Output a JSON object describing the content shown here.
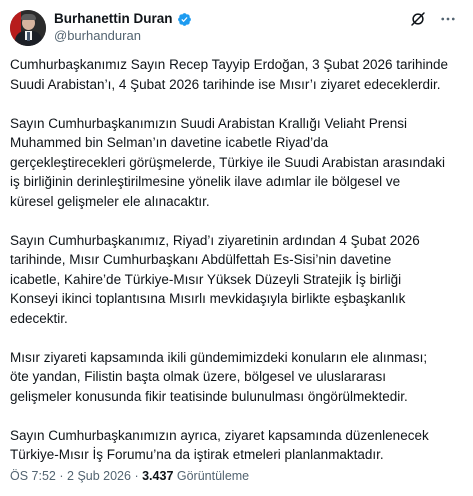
{
  "author": {
    "display_name": "Burhanettin Duran",
    "handle": "@burhanduran",
    "avatar_icon": "profile-photo",
    "verified_color": "#1d9bf0"
  },
  "actions": {
    "grok_icon": "grok-icon",
    "more_icon": "more-options-icon"
  },
  "tweet": {
    "paragraphs": [
      "Cumhurbaşkanımız Sayın Recep Tayyip Erdoğan, 3 Şubat 2026 tarihinde\nSuudi Arabistan’ı, 4 Şubat 2026 tarihinde ise Mısır’ı ziyaret edeceklerdir.",
      "Sayın Cumhurbaşkanımızın Suudi Arabistan Krallığı Veliaht Prensi\nMuhammed bin Selman’ın davetine icabetle Riyad’da\ngerçekleştirecekleri görüşmelerde, Türkiye ile Suudi Arabistan arasındaki\niş birliğinin derinleştirilmesine yönelik ilave adımlar ile bölgesel ve\nküresel gelişmeler ele alınacaktır.",
      "Sayın Cumhurbaşkanımız, Riyad’ı ziyaretinin ardından 4 Şubat 2026\ntarihinde, Mısır Cumhurbaşkanı Abdülfettah Es-Sisi’nin davetine\nicabetle, Kahire’de Türkiye-Mısır Yüksek Düzeyli Stratejik İş birliği\nKonseyi ikinci toplantısına Mısırlı mevkidaşıyla birlikte eşbaşkanlık\nedecektir.",
      "Mısır ziyareti kapsamında ikili gündemimizdeki konuların ele alınması;\nöte yandan, Filistin başta olmak üzere, bölgesel ve uluslararası\ngelişmeler konusunda fikir teatisinde bulunulması öngörülmektedir.",
      "Sayın Cumhurbaşkanımızın ayrıca, ziyaret kapsamında düzenlenecek\nTürkiye-Mısır İş Forumu’na da iştirak etmeleri planlanmaktadır."
    ]
  },
  "meta": {
    "time": "ÖS 7:52",
    "separator": "·",
    "date": "2 Şub 2026",
    "views_count": "3.437",
    "views_label": "Görüntüleme"
  }
}
